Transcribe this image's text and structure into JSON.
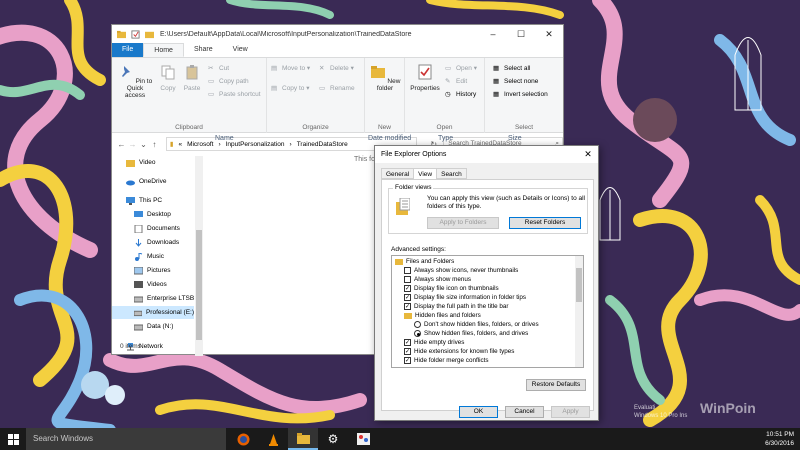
{
  "explorer": {
    "title_path": "E:\\Users\\Default\\AppData\\Local\\Microsoft\\InputPersonalization\\TrainedDataStore",
    "ribbon_tabs": [
      "File",
      "Home",
      "Share",
      "View"
    ],
    "clipboard": {
      "pin_label": "Pin to Quick access",
      "copy_label": "Copy",
      "paste_label": "Paste",
      "cut_label": "Cut",
      "copy_path_label": "Copy path",
      "paste_shortcut_label": "Paste shortcut",
      "group_label": "Clipboard"
    },
    "organize": {
      "move_to_label": "Move to",
      "delete_label": "Delete",
      "copy_to_label": "Copy to",
      "rename_label": "Rename",
      "group_label": "Organize"
    },
    "new": {
      "new_folder_label": "New folder",
      "group_label": "New"
    },
    "open": {
      "properties_label": "Properties",
      "open_label": "Open",
      "edit_label": "Edit",
      "history_label": "History",
      "group_label": "Open"
    },
    "select": {
      "select_all_label": "Select all",
      "select_none_label": "Select none",
      "invert_label": "Invert selection",
      "group_label": "Select"
    },
    "address": {
      "overflow": "«",
      "crumbs": [
        "Microsoft",
        "InputPersonalization",
        "TrainedDataStore"
      ],
      "search_placeholder": "Search TrainedDataStore"
    },
    "nav_items": [
      {
        "label": "Video",
        "icon": "folder-icon"
      },
      {
        "label": "OneDrive",
        "icon": "cloud-icon"
      },
      {
        "label": "This PC",
        "icon": "computer-icon"
      },
      {
        "label": "Desktop",
        "icon": "desktop-icon"
      },
      {
        "label": "Documents",
        "icon": "documents-icon"
      },
      {
        "label": "Downloads",
        "icon": "downloads-icon"
      },
      {
        "label": "Music",
        "icon": "music-icon"
      },
      {
        "label": "Pictures",
        "icon": "pictures-icon"
      },
      {
        "label": "Videos",
        "icon": "videos-icon"
      },
      {
        "label": "Enterprise LTSB (",
        "icon": "drive-icon"
      },
      {
        "label": "Professional (E:)",
        "icon": "drive-icon"
      },
      {
        "label": "Data (N:)",
        "icon": "drive-icon"
      },
      {
        "label": "Network",
        "icon": "network-icon"
      }
    ],
    "columns": [
      "Name",
      "Date modified",
      "Type",
      "Size"
    ],
    "empty_message": "This fol",
    "status": "0 items"
  },
  "dialog": {
    "title": "File Explorer Options",
    "tabs": [
      "General",
      "View",
      "Search"
    ],
    "folder_views": {
      "label": "Folder views",
      "description": "You can apply this view (such as Details or Icons) to all folders of this type.",
      "apply_button": "Apply to Folders",
      "reset_button": "Reset Folders"
    },
    "advanced_label": "Advanced settings:",
    "tree": [
      {
        "kind": "folder",
        "label": "Files and Folders",
        "indent": 0
      },
      {
        "kind": "check",
        "checked": false,
        "label": "Always show icons, never thumbnails",
        "indent": 1
      },
      {
        "kind": "check",
        "checked": false,
        "label": "Always show menus",
        "indent": 1
      },
      {
        "kind": "check",
        "checked": true,
        "label": "Display file icon on thumbnails",
        "indent": 1
      },
      {
        "kind": "check",
        "checked": true,
        "label": "Display file size information in folder tips",
        "indent": 1
      },
      {
        "kind": "check",
        "checked": true,
        "label": "Display the full path in the title bar",
        "indent": 1
      },
      {
        "kind": "folder",
        "label": "Hidden files and folders",
        "indent": 1
      },
      {
        "kind": "radio",
        "checked": false,
        "label": "Don't show hidden files, folders, or drives",
        "indent": 2
      },
      {
        "kind": "radio",
        "checked": true,
        "label": "Show hidden files, folders, and drives",
        "indent": 2
      },
      {
        "kind": "check",
        "checked": true,
        "label": "Hide empty drives",
        "indent": 1
      },
      {
        "kind": "check",
        "checked": true,
        "label": "Hide extensions for known file types",
        "indent": 1
      },
      {
        "kind": "check",
        "checked": true,
        "label": "Hide folder merge conflicts",
        "indent": 1
      }
    ],
    "restore_button": "Restore Defaults",
    "ok_button": "OK",
    "cancel_button": "Cancel",
    "apply_button": "Apply"
  },
  "taskbar": {
    "search_placeholder": "Search Windows",
    "apps": [
      "firefox-icon",
      "vlc-icon",
      "file-explorer-icon",
      "settings-icon",
      "paint-icon"
    ],
    "watermark_line1": "Evaluati",
    "watermark_line2": "Windows 10 Pro Ins",
    "watermark_brand": "WinPoin",
    "time": "10:51 PM",
    "date": "6/30/2016"
  },
  "colors": {
    "accent": "#1979ca",
    "selection": "#cce8ff",
    "taskbar": "#1a1a1a"
  }
}
